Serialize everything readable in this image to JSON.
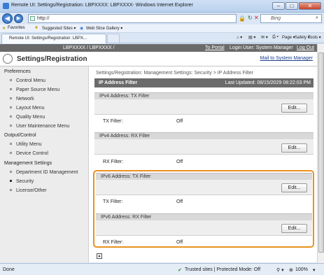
{
  "window": {
    "title": "Remote UI: Settings/Registration: LBPXXXX: LBPXXXX- Windows Internet Explorer",
    "min": "–",
    "max": "□",
    "close": "✕"
  },
  "address": {
    "url": "http://",
    "search_placeholder": "Bing"
  },
  "favorites": {
    "label": "Favorites",
    "suggested": "Suggested Sites ▾",
    "webslice": "Web Slice Gallery ▾"
  },
  "tab": {
    "title": "Remote UI: Settings/Registration: LBPX..."
  },
  "commands": {
    "page": "Page ▾",
    "safety": "Safety ▾",
    "tools": "Tools ▾"
  },
  "header": {
    "device": "LBPXXXX / LBPXXXX /",
    "to_portal": "To Portal",
    "login_user": "Login User: System Manager",
    "logout": "Log Out",
    "title": "Settings/Registration",
    "mail": "Mail to System Manager"
  },
  "sidebar": {
    "preferences": "Preferences",
    "pref_items": [
      "Control Menu",
      "Paper Source Menu",
      "Network",
      "Layout Menu",
      "Quality Menu",
      "User Maintenance Menu"
    ],
    "output": "Output/Control",
    "output_items": [
      "Utility Menu",
      "Device Control"
    ],
    "mgmt": "Management Settings",
    "mgmt_items": [
      "Department ID Management",
      "Security",
      "License/Other"
    ]
  },
  "main": {
    "breadcrumb": "Settings/Registration: Management Settings: Security > IP Address Filter",
    "page_title": "IP Address Filter",
    "last_updated": "Last Updated: 08/15/2029 08:22:03 PM",
    "edit_label": "Edit...",
    "sections": [
      {
        "title": "IPv4 Address: TX Filter",
        "field": "TX Filter:",
        "value": "Off"
      },
      {
        "title": "IPv4 Address: RX Filter",
        "field": "RX Filter:",
        "value": "Off"
      },
      {
        "title": "IPv6 Address: TX Filter",
        "field": "TX Filter:",
        "value": "Off"
      },
      {
        "title": "IPv6 Address: RX Filter",
        "field": "RX Filter:",
        "value": "Off"
      }
    ]
  },
  "status": {
    "left": "Done",
    "zone": "Trusted sites | Protected Mode: Off",
    "zoom": "100%"
  }
}
